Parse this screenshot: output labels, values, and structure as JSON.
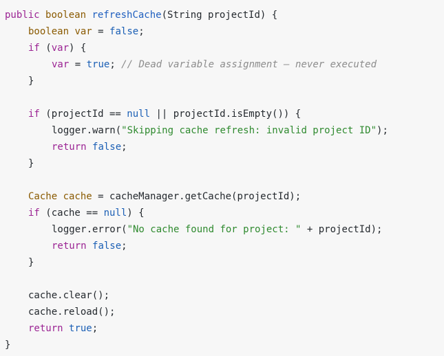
{
  "lines": [
    {
      "indent": 0,
      "tokens": [
        {
          "t": "public ",
          "c": "kw"
        },
        {
          "t": "boolean ",
          "c": "type"
        },
        {
          "t": "refreshCache",
          "c": "fn"
        },
        {
          "t": "(String projectId) {",
          "c": "pl"
        }
      ]
    },
    {
      "indent": 1,
      "tokens": [
        {
          "t": "boolean ",
          "c": "type"
        },
        {
          "t": "var",
          "c": "type"
        },
        {
          "t": " = ",
          "c": "pl"
        },
        {
          "t": "false",
          "c": "lit"
        },
        {
          "t": ";",
          "c": "pl"
        }
      ]
    },
    {
      "indent": 1,
      "tokens": [
        {
          "t": "if",
          "c": "kw"
        },
        {
          "t": " (",
          "c": "pl"
        },
        {
          "t": "var",
          "c": "kw"
        },
        {
          "t": ") {",
          "c": "pl"
        }
      ]
    },
    {
      "indent": 2,
      "tokens": [
        {
          "t": "var",
          "c": "kw"
        },
        {
          "t": " = ",
          "c": "pl"
        },
        {
          "t": "true",
          "c": "lit"
        },
        {
          "t": "; ",
          "c": "pl"
        },
        {
          "t": "// Dead variable assignment — never executed",
          "c": "cm"
        }
      ]
    },
    {
      "indent": 1,
      "tokens": [
        {
          "t": "}",
          "c": "pl"
        }
      ]
    },
    {
      "indent": 0,
      "tokens": []
    },
    {
      "indent": 1,
      "tokens": [
        {
          "t": "if",
          "c": "kw"
        },
        {
          "t": " (projectId == ",
          "c": "pl"
        },
        {
          "t": "null",
          "c": "lit"
        },
        {
          "t": " || projectId.isEmpty()) {",
          "c": "pl"
        }
      ]
    },
    {
      "indent": 2,
      "tokens": [
        {
          "t": "logger.warn(",
          "c": "pl"
        },
        {
          "t": "\"Skipping cache refresh: invalid project ID\"",
          "c": "str"
        },
        {
          "t": ");",
          "c": "pl"
        }
      ]
    },
    {
      "indent": 2,
      "tokens": [
        {
          "t": "return ",
          "c": "kw"
        },
        {
          "t": "false",
          "c": "lit"
        },
        {
          "t": ";",
          "c": "pl"
        }
      ]
    },
    {
      "indent": 1,
      "tokens": [
        {
          "t": "}",
          "c": "pl"
        }
      ]
    },
    {
      "indent": 0,
      "tokens": []
    },
    {
      "indent": 1,
      "tokens": [
        {
          "t": "Cache ",
          "c": "type"
        },
        {
          "t": "cache",
          "c": "type"
        },
        {
          "t": " = cacheManager.getCache(projectId);",
          "c": "pl"
        }
      ]
    },
    {
      "indent": 1,
      "tokens": [
        {
          "t": "if",
          "c": "kw"
        },
        {
          "t": " (cache == ",
          "c": "pl"
        },
        {
          "t": "null",
          "c": "lit"
        },
        {
          "t": ") {",
          "c": "pl"
        }
      ]
    },
    {
      "indent": 2,
      "tokens": [
        {
          "t": "logger.error(",
          "c": "pl"
        },
        {
          "t": "\"No cache found for project: \"",
          "c": "str"
        },
        {
          "t": " + projectId);",
          "c": "pl"
        }
      ]
    },
    {
      "indent": 2,
      "tokens": [
        {
          "t": "return ",
          "c": "kw"
        },
        {
          "t": "false",
          "c": "lit"
        },
        {
          "t": ";",
          "c": "pl"
        }
      ]
    },
    {
      "indent": 1,
      "tokens": [
        {
          "t": "}",
          "c": "pl"
        }
      ]
    },
    {
      "indent": 0,
      "tokens": []
    },
    {
      "indent": 1,
      "tokens": [
        {
          "t": "cache.clear();",
          "c": "pl"
        }
      ]
    },
    {
      "indent": 1,
      "tokens": [
        {
          "t": "cache.reload();",
          "c": "pl"
        }
      ]
    },
    {
      "indent": 1,
      "tokens": [
        {
          "t": "return ",
          "c": "kw"
        },
        {
          "t": "true",
          "c": "lit"
        },
        {
          "t": ";",
          "c": "pl"
        }
      ]
    },
    {
      "indent": 0,
      "tokens": [
        {
          "t": "}",
          "c": "pl"
        }
      ]
    }
  ],
  "colors": {
    "background": "#f7f7f7",
    "keyword": "#9b2393",
    "type": "#8a5a00",
    "literal": "#1b5fb5",
    "function": "#1f5fbf",
    "string": "#2f8a2f",
    "comment": "#8c8c8c",
    "plain": "#24292e"
  }
}
